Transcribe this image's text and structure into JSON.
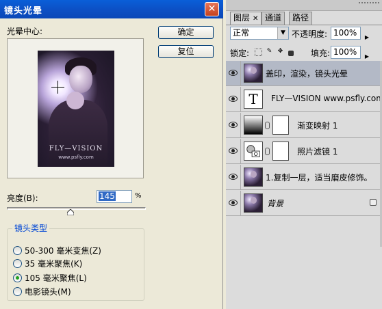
{
  "dialog": {
    "title": "镜头光晕",
    "close_glyph": "✕",
    "preview_label": "光晕中心:",
    "ok_label": "确定",
    "reset_label": "复位",
    "brightness_label": "亮度(B):",
    "brightness_value": "145",
    "brightness_unit": "%",
    "brightness_level_percent": 145,
    "lens_group_title": "镜头类型",
    "lens_options": [
      {
        "label": "50-300 毫米变焦(Z)",
        "selected": false
      },
      {
        "label": "35 毫米聚焦(K)",
        "selected": false
      },
      {
        "label": "105 毫米聚焦(L)",
        "selected": true
      },
      {
        "label": "电影镜头(M)",
        "selected": false
      }
    ],
    "preview_watermark_1": "FLY—VISION",
    "preview_watermark_2": "www.psfly.com"
  },
  "layers_panel": {
    "tabs": [
      {
        "label": "图层",
        "active": true,
        "closable": true
      },
      {
        "label": "通道",
        "active": false
      },
      {
        "label": "路径",
        "active": false
      }
    ],
    "blend_mode": "正常",
    "opacity_label": "不透明度:",
    "opacity_value": "100%",
    "lock_label": "锁定:",
    "fill_label": "填充:",
    "fill_value": "100%",
    "layers": [
      {
        "name": "盖印，渲染，镜头光晕",
        "thumb": "photo",
        "selected": true
      },
      {
        "name": "FLY—VISION www.psfly.com",
        "thumb": "text-T",
        "selected": false
      },
      {
        "name": "渐变映射 1",
        "thumb": "gradient-map",
        "mask": true,
        "selected": false
      },
      {
        "name": "照片滤镜 1",
        "thumb": "photo-filter",
        "mask": true,
        "selected": false
      },
      {
        "name": "1.复制一层，适当磨皮修饰。",
        "thumb": "photo",
        "selected": false
      },
      {
        "name": "背景",
        "thumb": "photo",
        "italic": true,
        "locked": true,
        "selected": false
      }
    ],
    "thumb_text_glyph": "T"
  }
}
